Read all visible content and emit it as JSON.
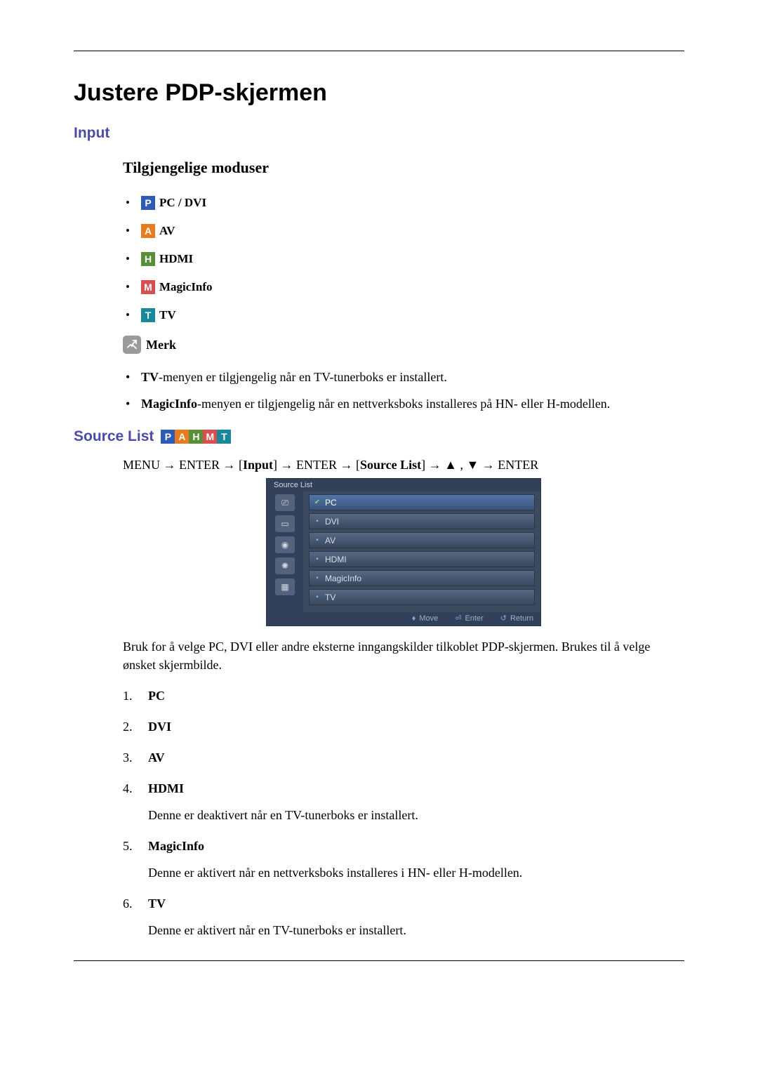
{
  "title": "Justere PDP-skjermen",
  "section_input": "Input",
  "subheading_modes": "Tilgjengelige moduser",
  "modes": {
    "p": {
      "letter": "P",
      "label": "PC / DVI"
    },
    "a": {
      "letter": "A",
      "label": "AV"
    },
    "h": {
      "letter": "H",
      "label": "HDMI"
    },
    "m": {
      "letter": "M",
      "label": "MagicInfo"
    },
    "t": {
      "letter": "T",
      "label": "TV"
    }
  },
  "note_label": "Merk",
  "notes": {
    "n1_pre": "TV",
    "n1_rest": "-menyen er tilgjengelig når en TV-tunerboks er installert.",
    "n2_pre": "MagicInfo",
    "n2_rest": "-menyen er tilgjengelig når en nettverksboks installeres på HN- eller H-modellen."
  },
  "section_source_list": "Source List",
  "nav": {
    "p1": "MENU → ENTER → [",
    "b1": "Input",
    "p2": "] → ENTER → [",
    "b2": "Source List",
    "p3": "] → ▲ , ▼ → ENTER"
  },
  "osd": {
    "header": "Source List",
    "items": [
      "PC",
      "DVI",
      "AV",
      "HDMI",
      "MagicInfo",
      "TV"
    ],
    "footer": {
      "move": "Move",
      "enter": "Enter",
      "return": "Return"
    }
  },
  "body_text": "Bruk for å velge PC, DVI eller andre eksterne inngangskilder tilkoblet PDP-skjermen. Brukes til å velge ønsket skjermbilde.",
  "ordered": [
    {
      "label": "PC",
      "desc": ""
    },
    {
      "label": "DVI",
      "desc": ""
    },
    {
      "label": "AV",
      "desc": ""
    },
    {
      "label": "HDMI",
      "desc": "Denne er deaktivert når en TV-tunerboks er installert."
    },
    {
      "label": "MagicInfo",
      "desc": "Denne er aktivert når en nettverksboks installeres i HN- eller H-modellen."
    },
    {
      "label": "TV",
      "desc": "Denne er aktivert når en TV-tunerboks er installert."
    }
  ]
}
